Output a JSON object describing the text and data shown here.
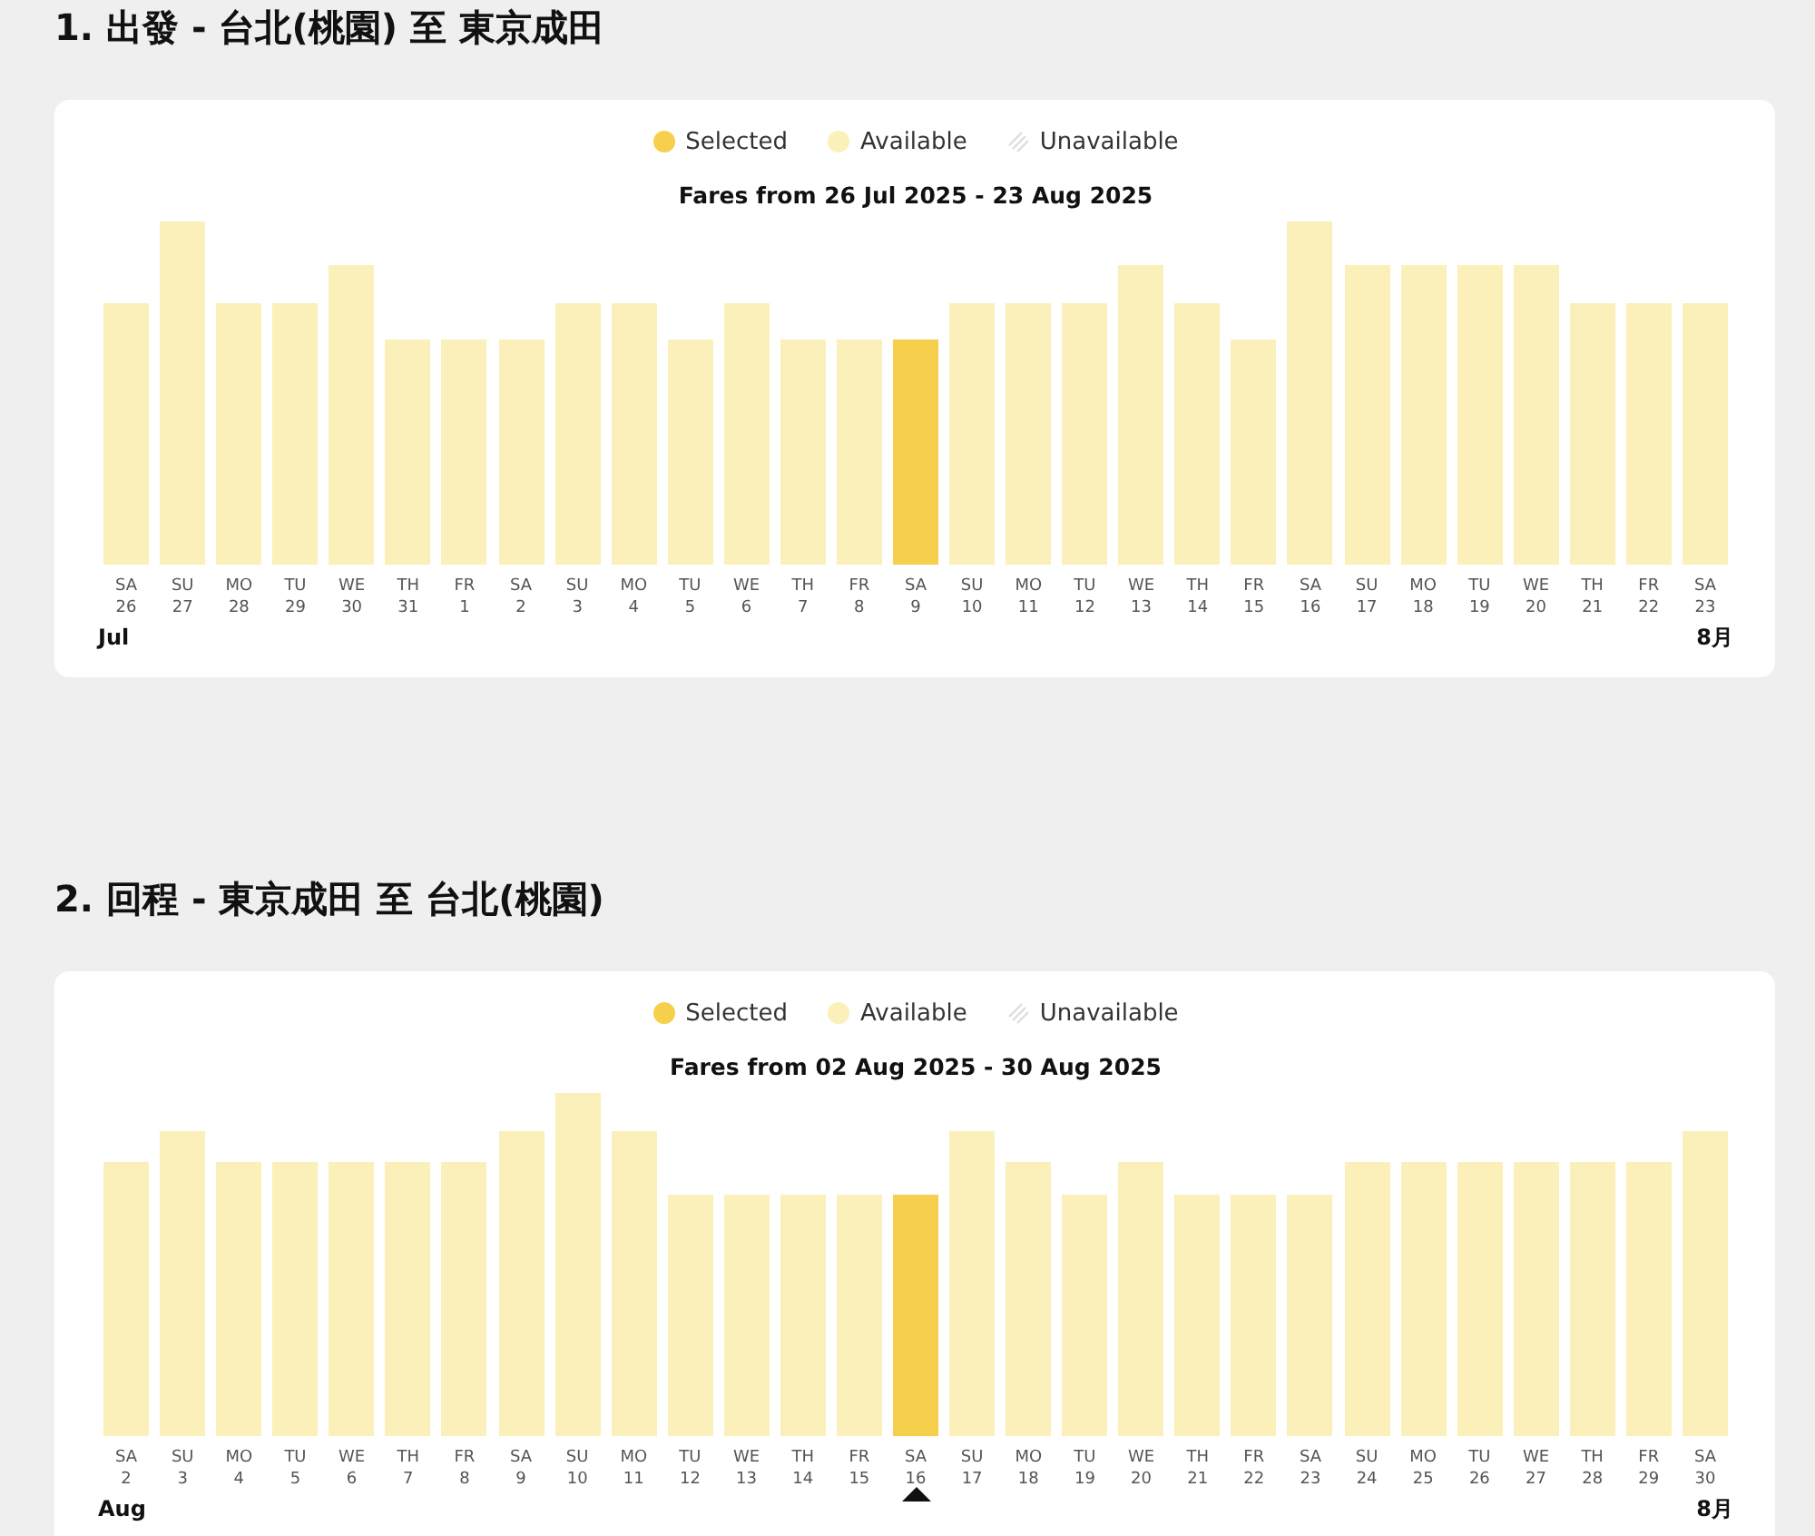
{
  "sections": [
    {
      "heading": "1. 出發 - 台北(桃園) 至 東京成田",
      "legend": [
        {
          "kind": "selected",
          "label": "Selected"
        },
        {
          "kind": "available",
          "label": "Available"
        },
        {
          "kind": "unavailable",
          "label": "Unavailable"
        }
      ],
      "title": "Fares from 26 Jul 2025 - 23 Aug 2025",
      "pointer": false,
      "month_start": "Jul",
      "month_end": "8月",
      "days": [
        {
          "weekday": "SA",
          "date": "26",
          "selected": false
        },
        {
          "weekday": "SU",
          "date": "27",
          "selected": false
        },
        {
          "weekday": "MO",
          "date": "28",
          "selected": false
        },
        {
          "weekday": "TU",
          "date": "29",
          "selected": false
        },
        {
          "weekday": "WE",
          "date": "30",
          "selected": false
        },
        {
          "weekday": "TH",
          "date": "31",
          "selected": false
        },
        {
          "weekday": "FR",
          "date": "1",
          "selected": false
        },
        {
          "weekday": "SA",
          "date": "2",
          "selected": false
        },
        {
          "weekday": "SU",
          "date": "3",
          "selected": false
        },
        {
          "weekday": "MO",
          "date": "4",
          "selected": false
        },
        {
          "weekday": "TU",
          "date": "5",
          "selected": false
        },
        {
          "weekday": "WE",
          "date": "6",
          "selected": false
        },
        {
          "weekday": "TH",
          "date": "7",
          "selected": false
        },
        {
          "weekday": "FR",
          "date": "8",
          "selected": false
        },
        {
          "weekday": "SA",
          "date": "9",
          "selected": true
        },
        {
          "weekday": "SU",
          "date": "10",
          "selected": false
        },
        {
          "weekday": "MO",
          "date": "11",
          "selected": false
        },
        {
          "weekday": "TU",
          "date": "12",
          "selected": false
        },
        {
          "weekday": "WE",
          "date": "13",
          "selected": false
        },
        {
          "weekday": "TH",
          "date": "14",
          "selected": false
        },
        {
          "weekday": "FR",
          "date": "15",
          "selected": false
        },
        {
          "weekday": "SA",
          "date": "16",
          "selected": false
        },
        {
          "weekday": "SU",
          "date": "17",
          "selected": false
        },
        {
          "weekday": "MO",
          "date": "18",
          "selected": false
        },
        {
          "weekday": "TU",
          "date": "19",
          "selected": false
        },
        {
          "weekday": "WE",
          "date": "20",
          "selected": false
        },
        {
          "weekday": "TH",
          "date": "21",
          "selected": false
        },
        {
          "weekday": "FR",
          "date": "22",
          "selected": false
        },
        {
          "weekday": "SA",
          "date": "23",
          "selected": false
        }
      ]
    },
    {
      "heading": "2. 回程 - 東京成田 至 台北(桃園)",
      "legend": [
        {
          "kind": "selected",
          "label": "Selected"
        },
        {
          "kind": "available",
          "label": "Available"
        },
        {
          "kind": "unavailable",
          "label": "Unavailable"
        }
      ],
      "title": "Fares from 02 Aug 2025 - 30 Aug 2025",
      "pointer": true,
      "month_start": "Aug",
      "month_end": "8月",
      "days": [
        {
          "weekday": "SA",
          "date": "2",
          "selected": false
        },
        {
          "weekday": "SU",
          "date": "3",
          "selected": false
        },
        {
          "weekday": "MO",
          "date": "4",
          "selected": false
        },
        {
          "weekday": "TU",
          "date": "5",
          "selected": false
        },
        {
          "weekday": "WE",
          "date": "6",
          "selected": false
        },
        {
          "weekday": "TH",
          "date": "7",
          "selected": false
        },
        {
          "weekday": "FR",
          "date": "8",
          "selected": false
        },
        {
          "weekday": "SA",
          "date": "9",
          "selected": false
        },
        {
          "weekday": "SU",
          "date": "10",
          "selected": false
        },
        {
          "weekday": "MO",
          "date": "11",
          "selected": false
        },
        {
          "weekday": "TU",
          "date": "12",
          "selected": false
        },
        {
          "weekday": "WE",
          "date": "13",
          "selected": false
        },
        {
          "weekday": "TH",
          "date": "14",
          "selected": false
        },
        {
          "weekday": "FR",
          "date": "15",
          "selected": false
        },
        {
          "weekday": "SA",
          "date": "16",
          "selected": true
        },
        {
          "weekday": "SU",
          "date": "17",
          "selected": false
        },
        {
          "weekday": "MO",
          "date": "18",
          "selected": false
        },
        {
          "weekday": "TU",
          "date": "19",
          "selected": false
        },
        {
          "weekday": "WE",
          "date": "20",
          "selected": false
        },
        {
          "weekday": "TH",
          "date": "21",
          "selected": false
        },
        {
          "weekday": "FR",
          "date": "22",
          "selected": false
        },
        {
          "weekday": "SA",
          "date": "23",
          "selected": false
        },
        {
          "weekday": "SU",
          "date": "24",
          "selected": false
        },
        {
          "weekday": "MO",
          "date": "25",
          "selected": false
        },
        {
          "weekday": "TU",
          "date": "26",
          "selected": false
        },
        {
          "weekday": "WE",
          "date": "27",
          "selected": false
        },
        {
          "weekday": "TH",
          "date": "28",
          "selected": false
        },
        {
          "weekday": "FR",
          "date": "29",
          "selected": false
        },
        {
          "weekday": "SA",
          "date": "30",
          "selected": false
        }
      ]
    }
  ]
}
